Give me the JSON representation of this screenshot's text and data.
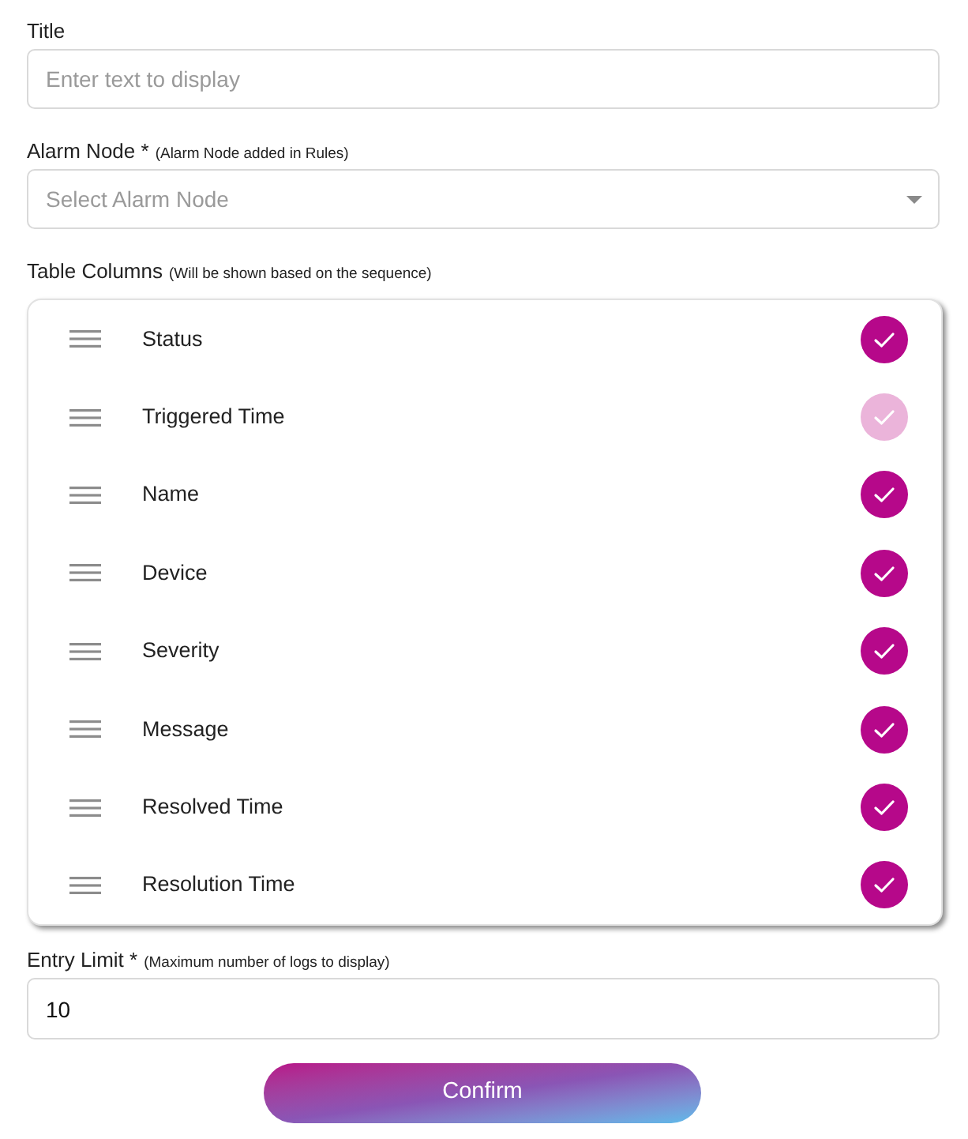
{
  "title_field": {
    "label": "Title",
    "placeholder": "Enter text to display"
  },
  "alarm_node": {
    "label": "Alarm Node *",
    "hint": "(Alarm Node added in Rules)",
    "placeholder": "Select Alarm Node"
  },
  "table_columns": {
    "label": "Table Columns",
    "hint": "(Will be shown based on the sequence)",
    "items": [
      {
        "name": "Status",
        "checked": true,
        "disabled": false
      },
      {
        "name": "Triggered Time",
        "checked": true,
        "disabled": true
      },
      {
        "name": "Name",
        "checked": true,
        "disabled": false
      },
      {
        "name": "Device",
        "checked": true,
        "disabled": false
      },
      {
        "name": "Severity",
        "checked": true,
        "disabled": false
      },
      {
        "name": "Message",
        "checked": true,
        "disabled": false
      },
      {
        "name": "Resolved Time",
        "checked": true,
        "disabled": false
      },
      {
        "name": "Resolution Time",
        "checked": true,
        "disabled": false
      }
    ]
  },
  "entry_limit": {
    "label": "Entry Limit *",
    "hint": "(Maximum number of logs to display)",
    "value": "10"
  },
  "buttons": [
    "Confirm"
  ]
}
